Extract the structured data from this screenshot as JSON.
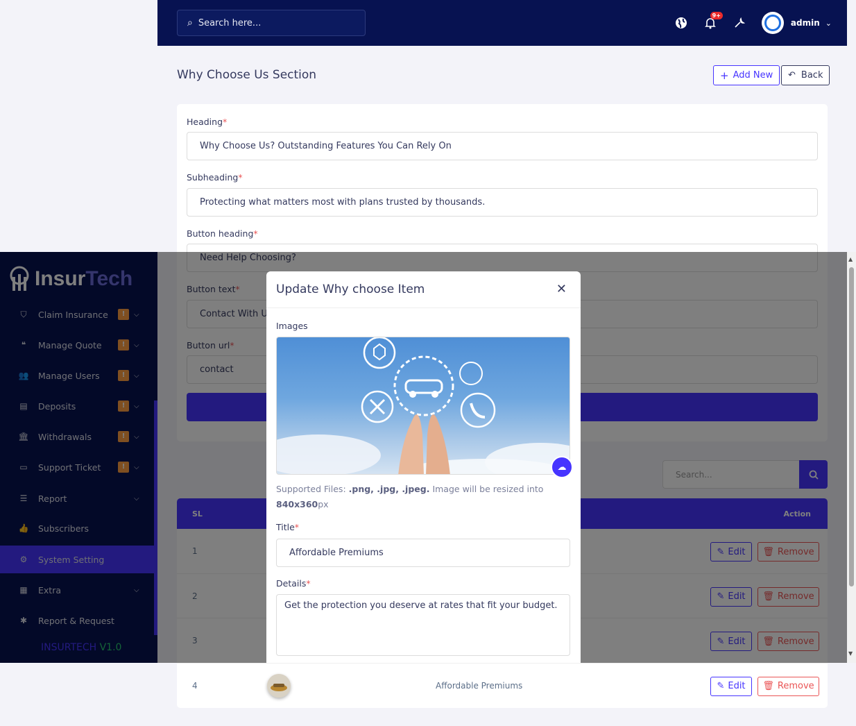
{
  "topbar": {
    "search_placeholder": "Search here...",
    "notification_badge": "9+",
    "user_name": "admin"
  },
  "page": {
    "title": "Why Choose Us Section",
    "add_new_label": "Add New",
    "back_label": "Back"
  },
  "form": {
    "heading_label": "Heading",
    "heading_value": "Why Choose Us? Outstanding Features You Can Rely On",
    "subheading_label": "Subheading",
    "subheading_value": "Protecting what matters most with plans trusted by thousands.",
    "button_heading_label": "Button heading",
    "button_heading_value": "Need Help Choosing?",
    "button_text_label": "Button text",
    "button_text_value": "Contact With U",
    "button_url_label": "Button url",
    "button_url_value": "contact",
    "required_mark": "*"
  },
  "table": {
    "search_placeholder": "Search...",
    "headers": {
      "sl": "SL",
      "action": "Action"
    },
    "rows": [
      {
        "sl": "1",
        "title": ""
      },
      {
        "sl": "2",
        "title": ""
      },
      {
        "sl": "3",
        "title": ""
      },
      {
        "sl": "4",
        "title": "Affordable Premiums"
      }
    ],
    "edit_label": "Edit",
    "remove_label": "Remove"
  },
  "sidebar": {
    "logo_part1": "Insur",
    "logo_part2": "Tech",
    "items": [
      {
        "label": "Claim Insurance",
        "icon": "shield-icon",
        "badge": "!",
        "caret": true
      },
      {
        "label": "Manage Quote",
        "icon": "quote-icon",
        "badge": "!",
        "caret": true
      },
      {
        "label": "Manage Users",
        "icon": "users-icon",
        "badge": "!",
        "caret": true
      },
      {
        "label": "Deposits",
        "icon": "deposit-icon",
        "badge": "!",
        "caret": true
      },
      {
        "label": "Withdrawals",
        "icon": "bank-icon",
        "badge": "!",
        "caret": true
      },
      {
        "label": "Support Ticket",
        "icon": "ticket-icon",
        "badge": "!",
        "caret": true
      },
      {
        "label": "Report",
        "icon": "list-icon",
        "badge": "",
        "caret": true
      },
      {
        "label": "Subscribers",
        "icon": "thumbs-up-icon",
        "badge": "",
        "caret": false
      },
      {
        "label": "System Setting",
        "icon": "gear-icon",
        "badge": "",
        "caret": false,
        "active": true
      },
      {
        "label": "Extra",
        "icon": "server-icon",
        "badge": "",
        "caret": true
      },
      {
        "label": "Report & Request",
        "icon": "bug-icon",
        "badge": "",
        "caret": false
      }
    ],
    "version_a": "INSURTECH",
    "version_b": "V1.0"
  },
  "modal": {
    "title": "Update Why choose Item",
    "images_label": "Images",
    "hint_prefix": "Supported Files: ",
    "hint_types": ".png, .jpg, .jpeg.",
    "hint_middle": " Image will be resized into ",
    "hint_size": "840x360",
    "hint_unit": "px",
    "title_label": "Title",
    "title_value": "Affordable Premiums",
    "details_label": "Details",
    "details_value": "Get the protection you deserve at rates that fit your budget."
  },
  "colors": {
    "navbar": "#071251",
    "primary": "#4634ff",
    "danger": "#ea5455",
    "warning": "#ff9f43"
  }
}
